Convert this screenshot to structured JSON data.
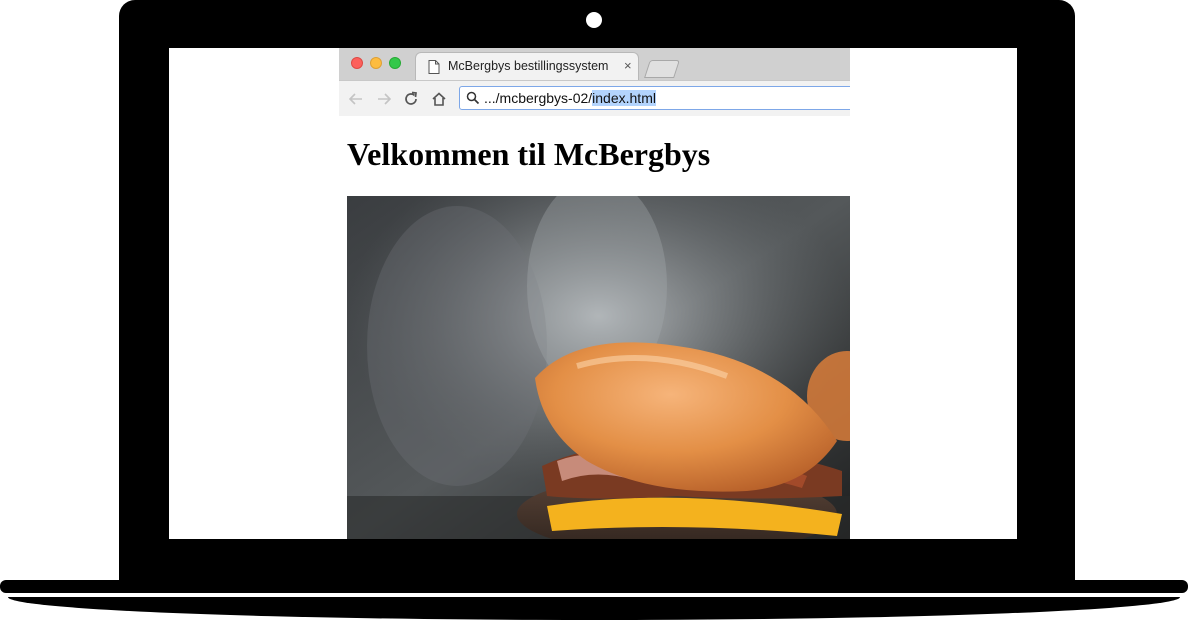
{
  "browser": {
    "tab_title": "McBergbys bestillingssystem",
    "tab_close": "×",
    "url_prefix": ".../mcbergbys-02/",
    "url_selected": "index.html",
    "icons": {
      "back": "arrow-left-icon",
      "forward": "arrow-right-icon",
      "reload": "reload-icon",
      "home": "home-icon",
      "search": "search-icon",
      "page": "page-icon"
    }
  },
  "page": {
    "heading": "Velkommen til McBergbys",
    "image": "burger-photo"
  },
  "colors": {
    "traffic_red": "#fc605c",
    "traffic_yellow": "#fdbc40",
    "traffic_green": "#34c84a",
    "url_selection": "#b3d4fd",
    "omnibox_focus": "#7da7e8"
  }
}
